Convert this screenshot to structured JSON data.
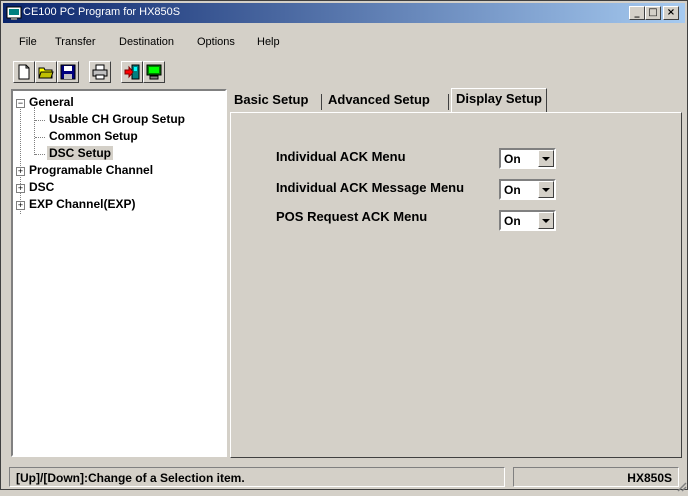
{
  "window": {
    "title": "CE100  PC Program for HX850S"
  },
  "titlebar_buttons": {
    "minimize": "_",
    "maximize": "□",
    "close": "×"
  },
  "menu": [
    "File",
    "Transfer",
    "Destination",
    "Options",
    "Help"
  ],
  "toolbar": [
    "new-file-icon",
    "open-folder-icon",
    "save-disk-icon",
    "print-icon",
    "transfer-to-device-icon",
    "transfer-from-device-icon"
  ],
  "tree": {
    "general": "General",
    "usable_ch_group": "Usable CH Group Setup",
    "common_setup": "Common Setup",
    "dsc_setup": "DSC Setup",
    "programable_channel": "Programable Channel",
    "dsc": "DSC",
    "exp_channel": "EXP Channel(EXP)",
    "expand_symbol": "+",
    "collapse_symbol": "−"
  },
  "tabs": [
    "Basic Setup",
    "Advanced Setup",
    "Display Setup"
  ],
  "active_tab": "Display Setup",
  "settings": [
    {
      "label": "Individual ACK Menu",
      "value": "On"
    },
    {
      "label": "Individual ACK Message Menu",
      "value": "On"
    },
    {
      "label": "POS Request ACK Menu",
      "value": "On"
    }
  ],
  "status": {
    "hint": "[Up]/[Down]:Change of a Selection item.",
    "model": "HX850S"
  },
  "colors": {
    "title_start": "#0a246a",
    "title_end": "#a6caf0",
    "face": "#d4d0c8"
  }
}
